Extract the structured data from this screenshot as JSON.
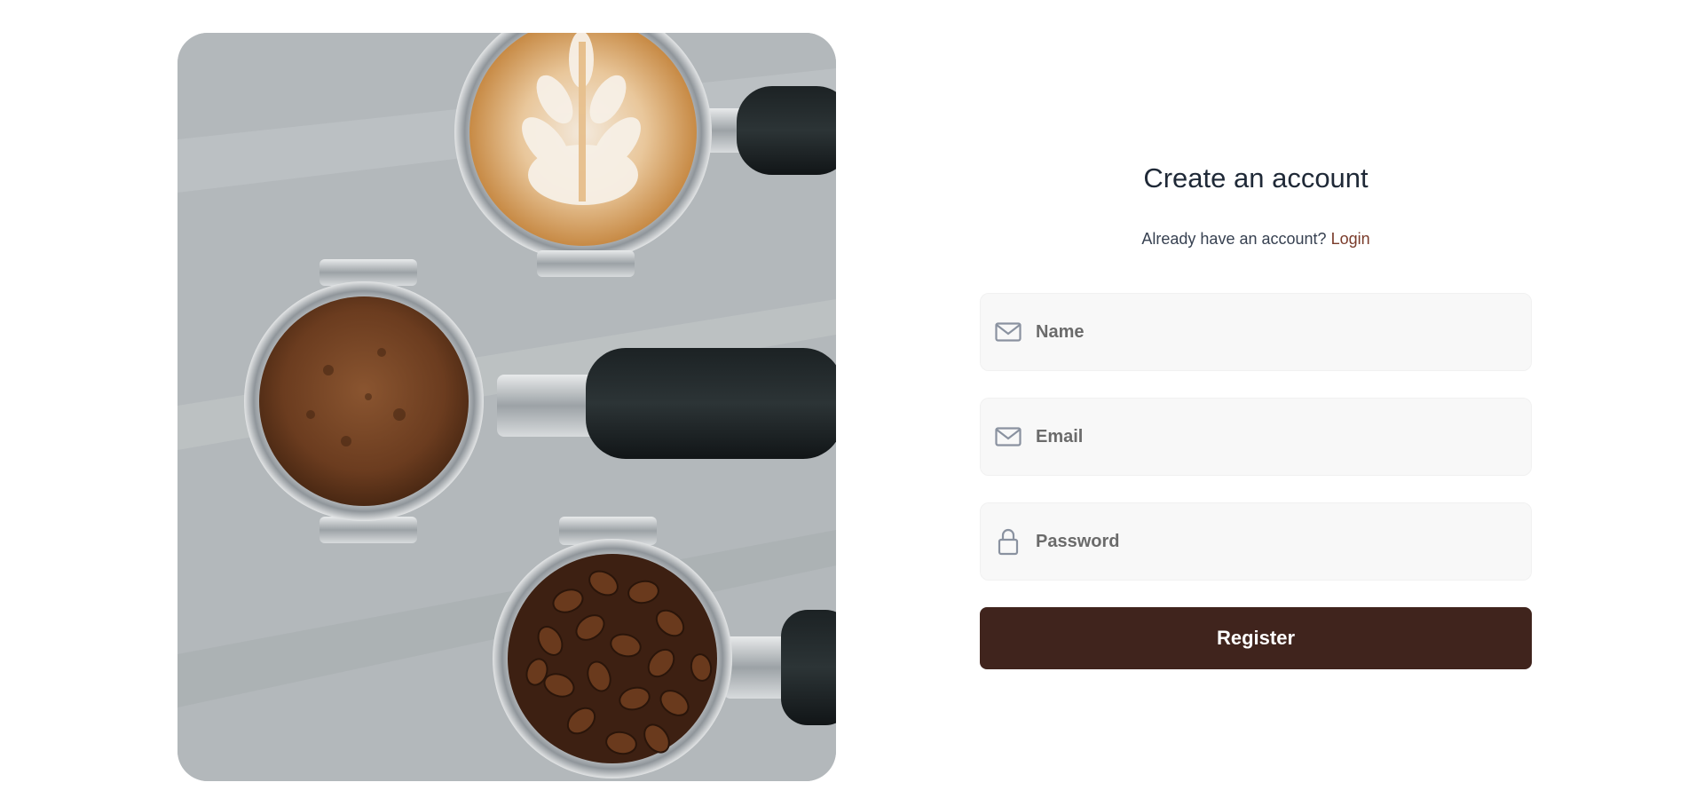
{
  "hero": {
    "icon": "coffee-portafilters-photo"
  },
  "form": {
    "title": "Create an account",
    "subtitle_prefix": "Already have an account?",
    "login_label": "Login",
    "fields": [
      {
        "placeholder": "Name",
        "value": "",
        "icon": "mail-icon"
      },
      {
        "placeholder": "Email",
        "value": "",
        "icon": "mail-icon"
      },
      {
        "placeholder": "Password",
        "value": "",
        "icon": "lock-icon"
      }
    ],
    "register_label": "Register"
  },
  "colors": {
    "accent": "#40241d",
    "link": "#7a3b2a",
    "field_bg": "#f8f8f8",
    "icon": "#8a92a0"
  }
}
